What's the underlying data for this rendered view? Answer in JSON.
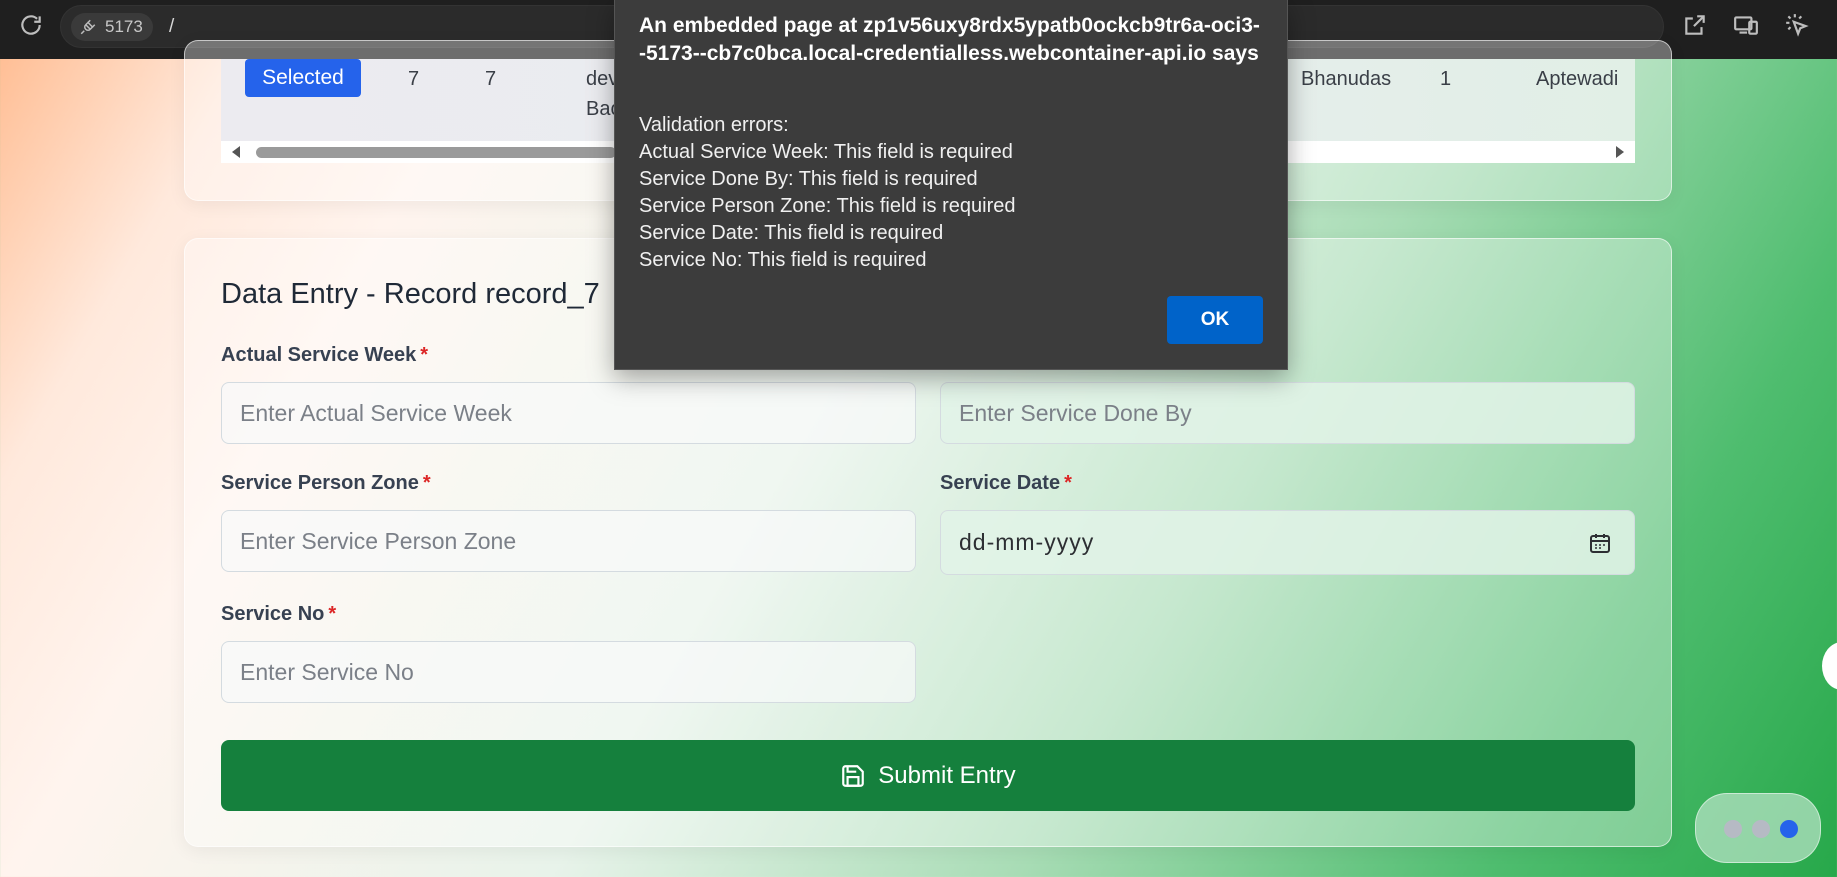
{
  "browser": {
    "port": "5173",
    "path": "/"
  },
  "table": {
    "selected_label": "Selected",
    "cells": {
      "col1": "7",
      "col2": "7",
      "col3_line1": "dev",
      "col3_line2": "Bac",
      "name": "Bhanudas",
      "num": "1",
      "place": "Aptewadi"
    }
  },
  "form": {
    "title": "Data Entry - Record record_7",
    "required_mark": "*",
    "fields": {
      "actual_service_week": {
        "label": "Actual Service Week",
        "placeholder": "Enter Actual Service Week"
      },
      "service_done_by": {
        "label": "Service Done By",
        "placeholder": "Enter Service Done By"
      },
      "service_person_zone": {
        "label": "Service Person Zone",
        "placeholder": "Enter Service Person Zone"
      },
      "service_date": {
        "label": "Service Date",
        "placeholder": "dd-mm-yyyy"
      },
      "service_no": {
        "label": "Service No",
        "placeholder": "Enter Service No"
      }
    },
    "submit_label": "Submit Entry"
  },
  "dialog": {
    "title": "An embedded page at zp1v56uxy8rdx5ypatb0ockcb9tr6a-oci3--5173--cb7c0bca.local-credentialless.webcontainer-api.io says",
    "lines": [
      "Validation errors:",
      "Actual Service Week: This field is required",
      "Service Done By: This field is required",
      "Service Person Zone: This field is required",
      "Service Date: This field is required",
      "Service No: This field is required"
    ],
    "ok_label": "OK"
  },
  "colors": {
    "accent_blue": "#2563eb",
    "submit_green": "#15803d",
    "dialog_bg": "#3c3c3c",
    "ok_blue": "#0063c9",
    "required_red": "#dc2626"
  },
  "icons": [
    "reload-icon",
    "plug-icon",
    "open-external-icon",
    "device-toggle-icon",
    "inspect-cursor-icon",
    "calendar-icon",
    "save-icon"
  ]
}
